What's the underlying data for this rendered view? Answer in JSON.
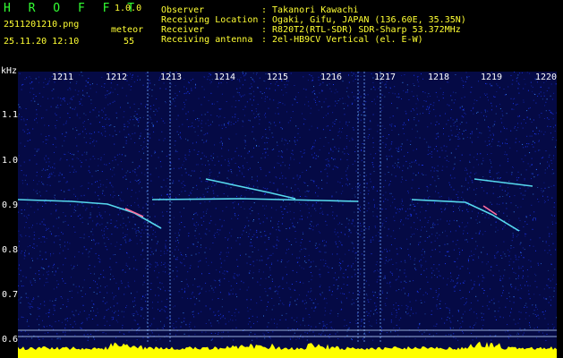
{
  "header": {
    "logo": "H R O F F T",
    "version": "1.0.0",
    "filename": "2511201210.png",
    "datetime": "25.11.20 12:10",
    "mode_label": "meteor",
    "count": "55",
    "info_labels": [
      "Observer",
      "Receiving Location",
      "Receiver",
      "Receiving antenna"
    ],
    "info_values": [
      ": Takanori Kawachi",
      ": Ogaki, Gifu, JAPAN (136.60E, 35.35N)",
      ": R820T2(RTL-SDR) SDR-Sharp 53.372MHz",
      ": 2el-HB9CV Vertical (el. E-W)"
    ]
  },
  "spectrogram": {
    "y_unit": "kHz",
    "y_ticks": [
      "1.1",
      "1.0",
      "0.9",
      "0.8",
      "0.7",
      "0.6"
    ],
    "minute_labels": [
      "1211",
      "1212",
      "1213",
      "1214",
      "1215",
      "1216",
      "1217",
      "1218",
      "1219",
      "1220"
    ],
    "colors": {
      "background": "#050a45",
      "noise": "#1e3cff",
      "trail": "#5ff0ff",
      "level": "#ffff00",
      "text_green": "#33ff33",
      "text_yellow": "#ffff33"
    }
  }
}
